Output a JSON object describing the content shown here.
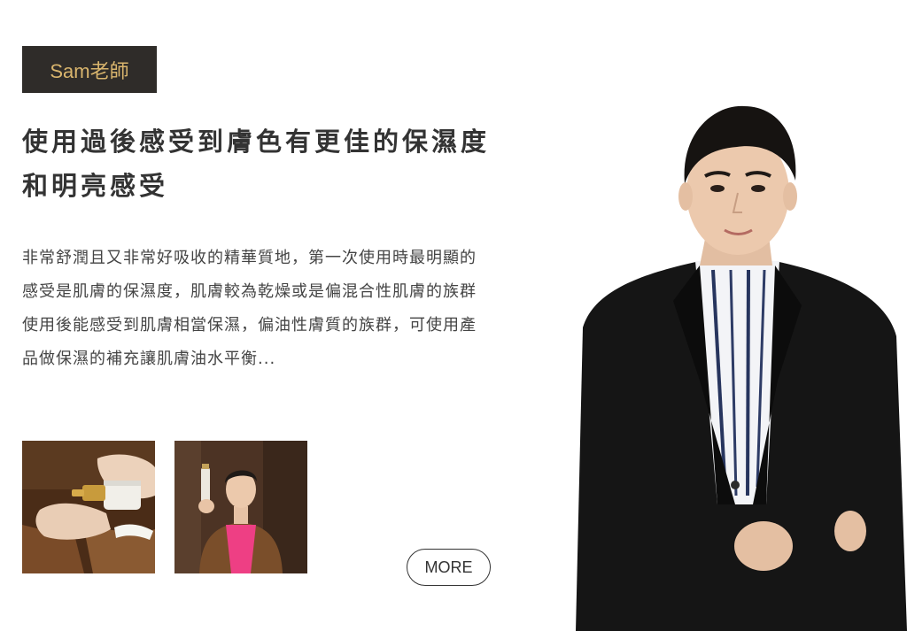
{
  "reviewer": {
    "name": "Sam老師"
  },
  "review": {
    "title": "使用過後感受到膚色有更佳的保濕度和明亮感受",
    "body": "非常舒潤且又非常好吸收的精華質地，第一次使用時最明顯的感受是肌膚的保濕度，肌膚較為乾燥或是偏混合性肌膚的族群使用後能感受到肌膚相當保濕，偏油性膚質的族群，可使用產品做保濕的補充讓肌膚油水平衡..."
  },
  "actions": {
    "more_label": "MORE"
  },
  "colors": {
    "tag_background": "#2f2c29",
    "tag_text": "#d9b56d",
    "heading_text": "#333333",
    "body_text": "#444444"
  }
}
